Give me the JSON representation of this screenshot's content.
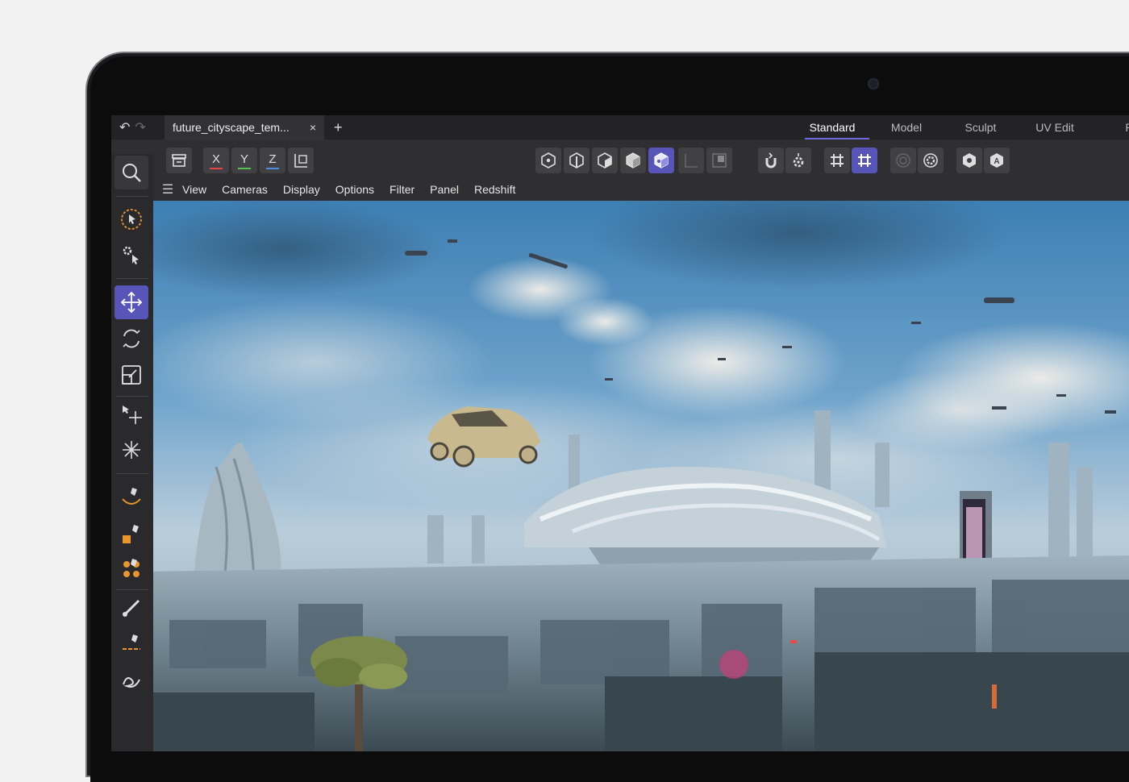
{
  "window": {
    "undo_icon": "undo-icon",
    "redo_icon": "redo-icon"
  },
  "tabs": {
    "document": "future_cityscape_tem...",
    "close": "×",
    "new_tab": "+"
  },
  "layouts": [
    "Standard",
    "Model",
    "Sculpt",
    "UV Edit",
    "P"
  ],
  "toolbar": {
    "axes": [
      {
        "label": "X",
        "color": "#e04848"
      },
      {
        "label": "Y",
        "color": "#58c052"
      },
      {
        "label": "Z",
        "color": "#4f8de0"
      }
    ]
  },
  "viewport_menu": [
    "View",
    "Cameras",
    "Display",
    "Options",
    "Filter",
    "Panel",
    "Redshift"
  ],
  "colors": {
    "accent": "#5756b8",
    "tool_orange": "#e8952e"
  }
}
